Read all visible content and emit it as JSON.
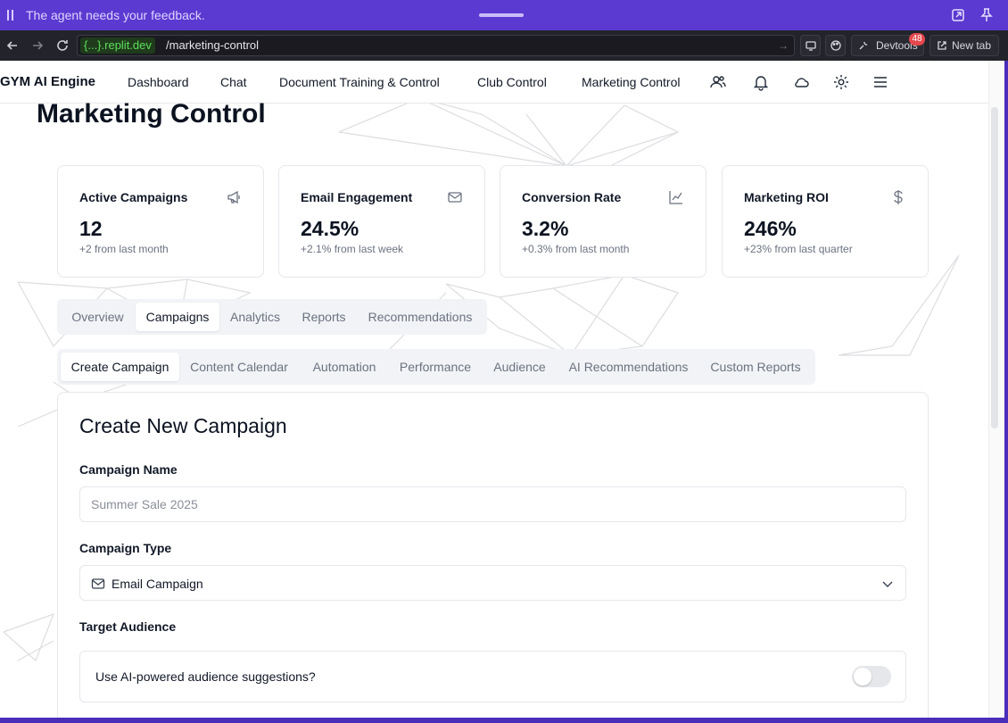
{
  "agent_bar": {
    "message": "The agent needs your feedback."
  },
  "browser": {
    "domain": "{...}.replit.dev",
    "path": "/marketing-control",
    "devtools_label": "Devtools",
    "devtools_badge": "48",
    "new_tab_label": "New tab"
  },
  "nav": {
    "brand": "GYM AI Engine",
    "links": [
      "Dashboard",
      "Chat",
      "Document Training & Control",
      "Club Control",
      "Marketing Control"
    ]
  },
  "page": {
    "title": "Marketing Control"
  },
  "stats": [
    {
      "label": "Active Campaigns",
      "value": "12",
      "sub": "+2 from last month",
      "icon": "megaphone-icon"
    },
    {
      "label": "Email Engagement",
      "value": "24.5%",
      "sub": "+2.1% from last week",
      "icon": "mail-icon"
    },
    {
      "label": "Conversion Rate",
      "value": "3.2%",
      "sub": "+0.3% from last month",
      "icon": "line-chart-icon"
    },
    {
      "label": "Marketing ROI",
      "value": "246%",
      "sub": "+23% from last quarter",
      "icon": "dollar-icon"
    }
  ],
  "main_tabs": [
    "Overview",
    "Campaigns",
    "Analytics",
    "Reports",
    "Recommendations"
  ],
  "main_tab_active": "Campaigns",
  "sub_tabs": [
    "Create Campaign",
    "Content Calendar",
    "Automation",
    "Performance",
    "Audience",
    "AI Recommendations",
    "Custom Reports"
  ],
  "sub_tab_active": "Create Campaign",
  "form": {
    "title": "Create New Campaign",
    "name_label": "Campaign Name",
    "name_placeholder": "Summer Sale 2025",
    "type_label": "Campaign Type",
    "type_value": "Email Campaign",
    "audience_label": "Target Audience",
    "ai_toggle_label": "Use AI-powered audience suggestions?",
    "ai_toggle_on": false
  }
}
